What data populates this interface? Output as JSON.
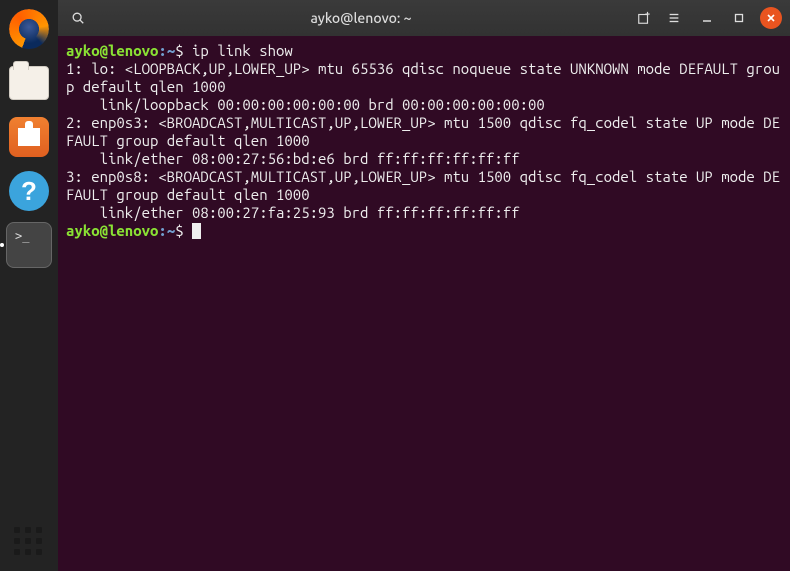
{
  "window": {
    "title": "ayko@lenovo: ~"
  },
  "dock": {
    "items": [
      {
        "name": "firefox"
      },
      {
        "name": "files"
      },
      {
        "name": "software"
      },
      {
        "name": "help",
        "glyph": "?"
      },
      {
        "name": "terminal",
        "glyph": ">_"
      }
    ]
  },
  "prompt": {
    "user_host": "ayko@lenovo",
    "separator": ":",
    "path": "~",
    "symbol": "$"
  },
  "command": "ip link show",
  "output_lines": [
    "1: lo: <LOOPBACK,UP,LOWER_UP> mtu 65536 qdisc noqueue state UNKNOWN mode DEFAULT group default qlen 1000",
    "    link/loopback 00:00:00:00:00:00 brd 00:00:00:00:00:00",
    "2: enp0s3: <BROADCAST,MULTICAST,UP,LOWER_UP> mtu 1500 qdisc fq_codel state UP mode DEFAULT group default qlen 1000",
    "    link/ether 08:00:27:56:bd:e6 brd ff:ff:ff:ff:ff:ff",
    "3: enp0s8: <BROADCAST,MULTICAST,UP,LOWER_UP> mtu 1500 qdisc fq_codel state UP mode DEFAULT group default qlen 1000",
    "    link/ether 08:00:27:fa:25:93 brd ff:ff:ff:ff:ff:ff"
  ]
}
